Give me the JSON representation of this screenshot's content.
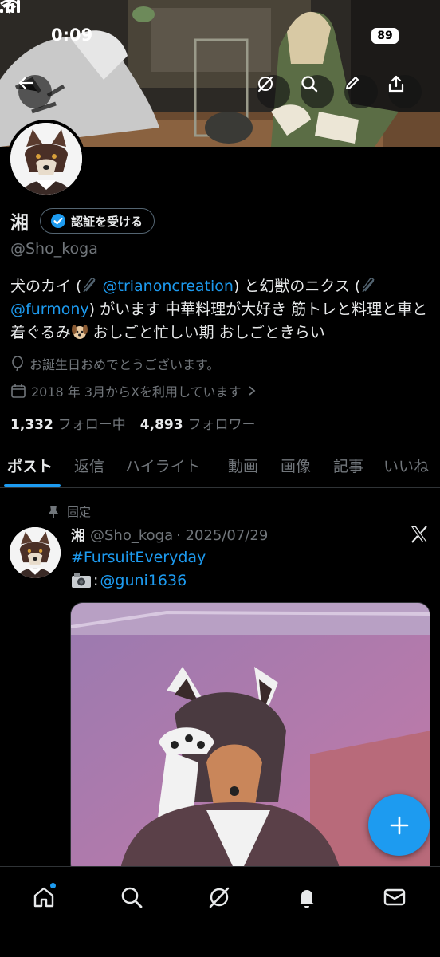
{
  "status_bar": {
    "time": "0:09",
    "battery": "89"
  },
  "profile": {
    "display_name": "湘",
    "verify_button": "認証を受ける",
    "handle": "@Sho_koga",
    "bio": {
      "part1": "犬のカイ (",
      "link1": "@trianoncreation",
      "part2": ") と幻獣のニクス (",
      "link2": "@furmony",
      "part3": ") がいます 中華料理が大好き 筋トレと料理と車と着ぐるみ",
      "part4": " おしごと忙しい期 おしごときらい"
    },
    "birthday": "お誕生日おめでとうございます。",
    "joined": "2018 年 3月からXを利用しています",
    "following_count": "1,332",
    "following_label": "フォロー中",
    "followers_count": "4,893",
    "followers_label": "フォロワー"
  },
  "tabs": [
    {
      "label": "ポスト"
    },
    {
      "label": "返信"
    },
    {
      "label": "ハイライト"
    },
    {
      "label": "動画"
    },
    {
      "label": "画像"
    },
    {
      "label": "記事"
    },
    {
      "label": "いいね"
    }
  ],
  "post": {
    "pinned_label": "固定",
    "name": "湘",
    "handle": "@Sho_koga",
    "date": "· 2025/07/29",
    "hashtag": "#FursuitEveryday",
    "credit_colon": ":",
    "credit_handle": "@guni1636"
  },
  "icons": {
    "back": "arrow-left-icon",
    "grok": "grok-icon",
    "search": "search-icon",
    "edit": "pencil-icon",
    "share": "share-icon",
    "compose": "plus-icon",
    "home": "home-icon",
    "notifications": "bell-icon",
    "messages": "envelope-icon"
  },
  "colors": {
    "accent": "#1d9bf0",
    "secondary_text": "#71767b",
    "divider": "#2f3336"
  }
}
